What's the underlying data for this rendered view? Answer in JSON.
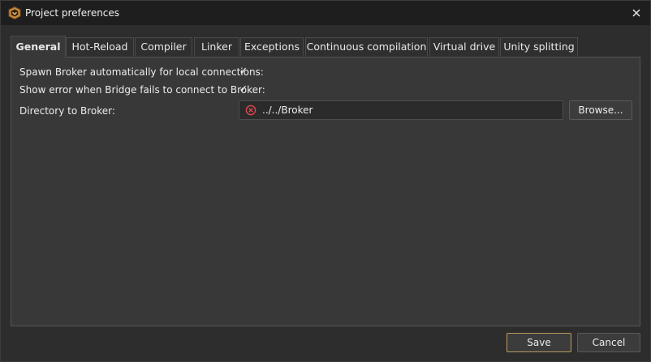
{
  "window": {
    "title": "Project preferences"
  },
  "tabs": [
    {
      "label": "General",
      "active": true
    },
    {
      "label": "Hot-Reload"
    },
    {
      "label": "Compiler"
    },
    {
      "label": "Linker"
    },
    {
      "label": "Exceptions"
    },
    {
      "label": "Continuous compilation"
    },
    {
      "label": "Virtual drive"
    },
    {
      "label": "Unity splitting"
    }
  ],
  "general": {
    "spawn_broker_label": "Spawn Broker automatically for local connections:",
    "spawn_broker_checked": true,
    "show_error_label": "Show error when Bridge fails to connect to Broker:",
    "show_error_checked": true,
    "directory_label": "Directory to Broker:",
    "directory_value": "../../Broker",
    "directory_status": "error",
    "browse_label": "Browse..."
  },
  "footer": {
    "save_label": "Save",
    "cancel_label": "Cancel"
  },
  "colors": {
    "error": "#e0474c",
    "primary_border": "#b89a5a"
  },
  "check_glyph": "✓"
}
